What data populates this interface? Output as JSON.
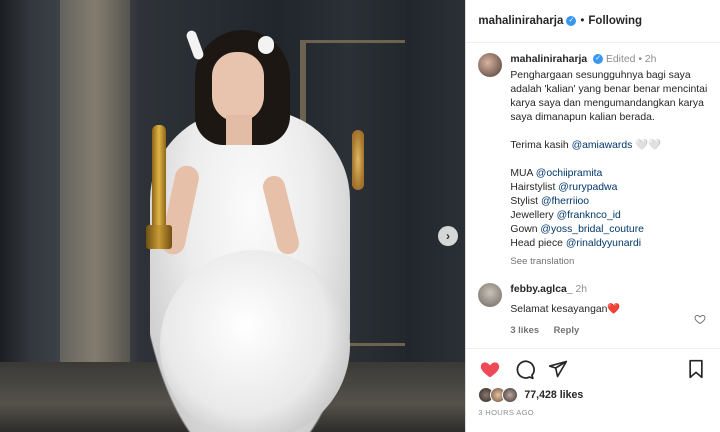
{
  "post": {
    "username": "mahaliniraharja",
    "following_label": "Following",
    "next_label": "›",
    "caption": {
      "username": "mahaliniraharja",
      "edited": "Edited",
      "time": "2h",
      "paragraph1": "Penghargaan sesungguhnya bagi saya adalah 'kalian' yang benar benar mencintai karya saya dan mengumandangkan karya saya dimanapun kalian berada.",
      "thanks_prefix": "Terima kasih ",
      "thanks_mention": "@amiawards",
      "thanks_suffix": " 🤍🤍",
      "credits": [
        {
          "role": "MUA ",
          "handle": "@ochiipramita"
        },
        {
          "role": "Hairstylist ",
          "handle": "@rurypadwa"
        },
        {
          "role": "Stylist ",
          "handle": "@fherriioo"
        },
        {
          "role": "Jewellery ",
          "handle": "@franknco_id"
        },
        {
          "role": "Gown ",
          "handle": "@yoss_bridal_couture"
        },
        {
          "role": "Head piece ",
          "handle": "@rinaldyyunardi"
        }
      ],
      "see_translation": "See translation"
    },
    "comment": {
      "username": "febby.aglca_",
      "time": "2h",
      "text": "Selamat kesayangan❤️",
      "likes": "3 likes",
      "reply": "Reply"
    },
    "likes_count": "77,428 likes",
    "timestamp": "3 HOURS AGO"
  },
  "icons": {
    "like": "heart-filled-icon",
    "comment": "comment-icon",
    "share": "paper-plane-icon",
    "save": "bookmark-icon"
  },
  "colors": {
    "like_red": "#ed4956",
    "verified_blue": "#3897f0",
    "mention_blue": "#00376b"
  }
}
